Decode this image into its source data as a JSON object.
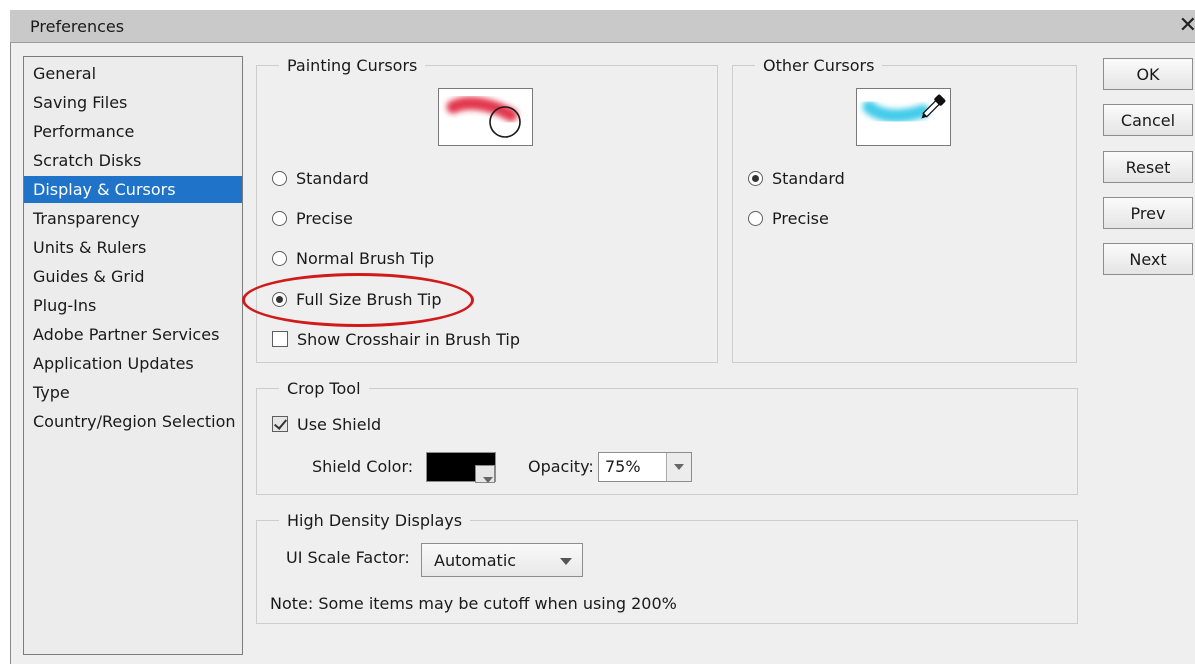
{
  "window": {
    "title": "Preferences",
    "close_glyph": "✕"
  },
  "categories": [
    {
      "label": "General"
    },
    {
      "label": "Saving Files"
    },
    {
      "label": "Performance"
    },
    {
      "label": "Scratch Disks"
    },
    {
      "label": "Display & Cursors",
      "selected": true
    },
    {
      "label": "Transparency"
    },
    {
      "label": "Units & Rulers"
    },
    {
      "label": "Guides & Grid"
    },
    {
      "label": "Plug-Ins"
    },
    {
      "label": "Adobe Partner Services"
    },
    {
      "label": "Application Updates"
    },
    {
      "label": "Type"
    },
    {
      "label": "Country/Region Selection"
    }
  ],
  "painting_cursors": {
    "legend": "Painting Cursors",
    "options": {
      "standard": "Standard",
      "precise": "Precise",
      "normal_brush_tip": "Normal Brush Tip",
      "full_size_brush_tip": "Full Size Brush Tip"
    },
    "selected": "Full Size Brush Tip",
    "show_crosshair_label": "Show Crosshair in Brush Tip",
    "show_crosshair_checked": false
  },
  "other_cursors": {
    "legend": "Other Cursors",
    "options": {
      "standard": "Standard",
      "precise": "Precise"
    },
    "selected": "Standard"
  },
  "crop_tool": {
    "legend": "Crop Tool",
    "use_shield_label": "Use Shield",
    "use_shield_checked": true,
    "shield_color_label": "Shield Color:",
    "shield_color": "#000000",
    "opacity_label": "Opacity:",
    "opacity_value": "75%"
  },
  "high_density": {
    "legend": "High Density Displays",
    "ui_scale_label": "UI Scale Factor:",
    "ui_scale_value": "Automatic",
    "note": "Note: Some items may be cutoff when using 200%"
  },
  "buttons": {
    "ok": "OK",
    "cancel": "Cancel",
    "reset": "Reset",
    "prev": "Prev",
    "next": "Next"
  },
  "colors": {
    "selection": "#1f73c8",
    "highlight_ellipse": "#d11a1a",
    "brush_red": "#e0203a",
    "brush_cyan": "#2fc6e6"
  }
}
